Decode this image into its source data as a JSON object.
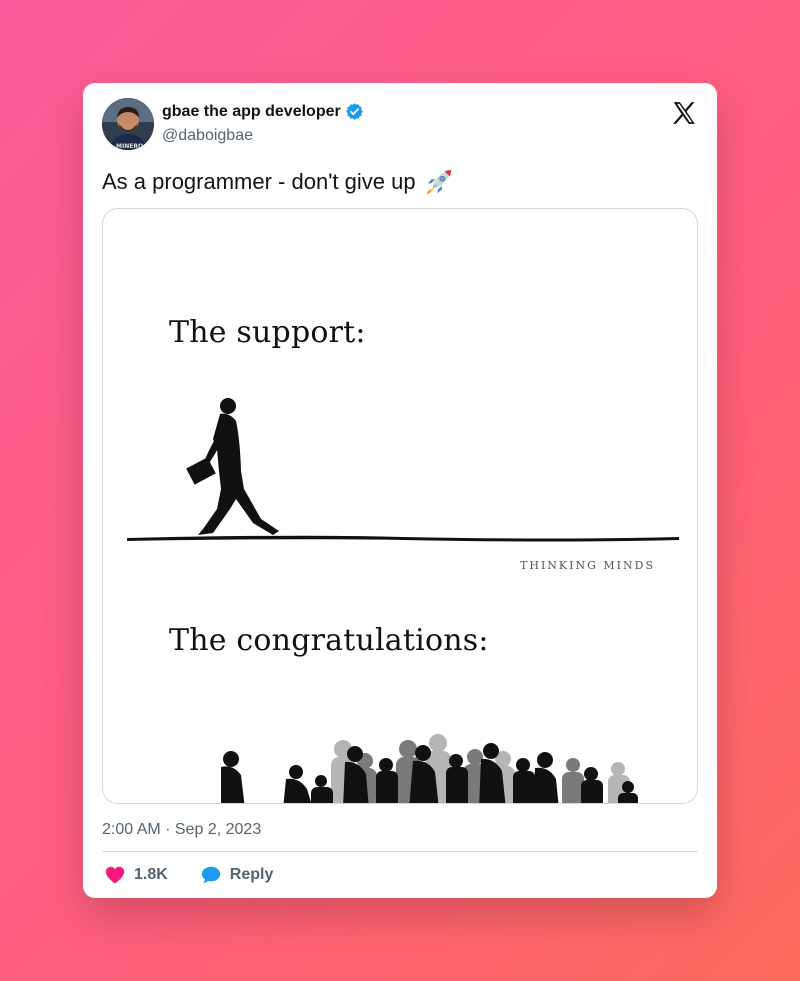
{
  "tweet": {
    "author": {
      "name": "gbae the app developer",
      "handle": "@daboigbae",
      "avatar_icon": "avatar-photo",
      "verified_icon": "verified-badge-icon"
    },
    "platform_icon": "x-logo-icon",
    "text": "As a programmer - don't give up",
    "emoji_icon": "rocket-icon",
    "media": {
      "support_label": "The support:",
      "watermark": "THINKING MINDS",
      "congrats_label": "The congratulations:"
    },
    "timestamp": "2:00 AM · Sep 2, 2023",
    "actions": {
      "like_count": "1.8K",
      "reply_label": "Reply"
    }
  },
  "colors": {
    "like": "#f91880",
    "reply": "#1d9bf0",
    "verified": "#1d9bf0",
    "muted_text": "#536471"
  }
}
